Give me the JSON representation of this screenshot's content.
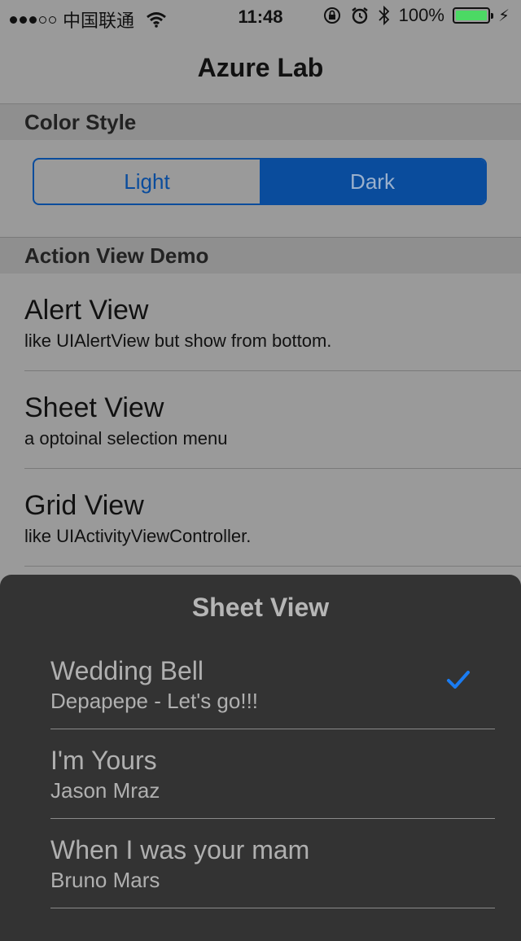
{
  "status_bar": {
    "carrier": "中国联通",
    "time": "11:48",
    "battery_percent": "100%",
    "battery_level": 1.0,
    "signal_bars_filled": 3,
    "signal_bars_total": 5
  },
  "nav": {
    "title": "Azure Lab"
  },
  "color_style": {
    "header": "Color Style",
    "options": [
      "Light",
      "Dark"
    ],
    "selected": "Dark",
    "accent": "#0a4c9c"
  },
  "action_view_demo": {
    "header": "Action View Demo",
    "items": [
      {
        "title": "Alert View",
        "subtitle": "like UIAlertView but show from bottom."
      },
      {
        "title": "Sheet View",
        "subtitle": "a optoinal selection menu"
      },
      {
        "title": "Grid View",
        "subtitle": "like UIActivityViewController."
      }
    ]
  },
  "sheet": {
    "title": "Sheet View",
    "items": [
      {
        "title": "Wedding Bell",
        "subtitle": "Depapepe - Let's go!!!",
        "checked": true
      },
      {
        "title": "I'm Yours",
        "subtitle": "Jason Mraz",
        "checked": false
      },
      {
        "title": "When I was your mam",
        "subtitle": "Bruno Mars",
        "checked": false
      }
    ],
    "check_color": "#1a7cf2"
  }
}
